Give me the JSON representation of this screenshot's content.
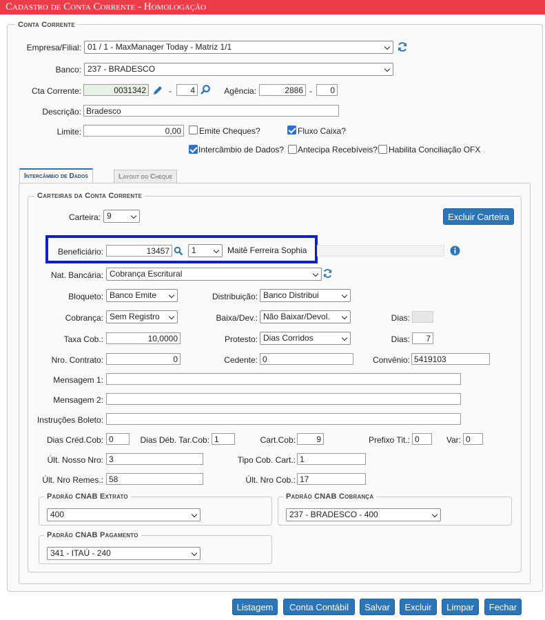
{
  "title": "Cadastro de Conta Corrente   - Homologação",
  "conta_corrente": {
    "legend": "Conta Corrente",
    "empresa_label": "Empresa/Filial:",
    "empresa_value": "01 / 1 - MaxManager Today - Matriz 1/1",
    "banco_label": "Banco:",
    "banco_value": "237 - BRADESCO",
    "cta_label": "Cta Corrente:",
    "cta_value": "0031342",
    "cta_digit": "4",
    "agencia_label": "Agência:",
    "agencia_value": "2886",
    "agencia_digit": "0",
    "descricao_label": "Descrição:",
    "descricao_value": "Bradesco",
    "limite_label": "Limite:",
    "limite_value": "0,00",
    "emite_cheques_label": "Emite Cheques?",
    "fluxo_caixa_label": "Fluxo Caixa?",
    "intercambio_label": "Intercâmbio de Dados?",
    "antecipa_label": "Antecipa Recebíveis?",
    "conciliacao_label": "Habilita Conciliação OFX"
  },
  "tabs": {
    "intercambio": "Intercâmbio de Dados",
    "layout_cheque": "Layout do Cheque"
  },
  "carteiras": {
    "legend": "Carteiras da Conta Corrente",
    "carteira_label": "Carteira:",
    "carteira_value": "9",
    "excluir_carteira": "Excluir Carteira",
    "beneficiario_label": "Beneficiário:",
    "beneficiario_code": "13457",
    "beneficiario_seq": "1",
    "beneficiario_name": "Maitê Ferreira Sophia",
    "nat_bancaria_label": "Nat. Bancária:",
    "nat_bancaria_value": "Cobrança Escritural",
    "bloqueto_label": "Bloqueto:",
    "bloqueto_value": "Banco Emite",
    "distribuicao_label": "Distribuição:",
    "distribuicao_value": "Banco Distribui",
    "cobranca_label": "Cobrança:",
    "cobranca_value": "Sem Registro",
    "baixa_label": "Baixa/Dev.:",
    "baixa_value": "Não Baixar/Devol.",
    "dias_label": "Dias:",
    "dias1_value": "",
    "taxa_label": "Taxa Cob.:",
    "taxa_value": "10,0000",
    "protesto_label": "Protesto:",
    "protesto_value": "Dias Corridos",
    "dias2_value": "7",
    "nro_contrato_label": "Nro. Contrato:",
    "nro_contrato_value": "0",
    "cedente_label": "Cedente:",
    "cedente_value": "0",
    "convenio_label": "Convênio:",
    "convenio_value": "5419103",
    "mensagem1_label": "Mensagem 1:",
    "mensagem1_value": "",
    "mensagem2_label": "Mensagem 2:",
    "mensagem2_value": "",
    "instrucoes_label": "Instruções Boleto:",
    "instrucoes_value": "",
    "dias_cred_label": "Dias Créd.Cob:",
    "dias_cred_value": "0",
    "dias_deb_label": "Dias Déb. Tar.Cob:",
    "dias_deb_value": "1",
    "cart_cob_label": "Cart.Cob:",
    "cart_cob_value": "9",
    "prefixo_label": "Prefixo Tit.:",
    "prefixo_value": "0",
    "var_label": "Var:",
    "var_value": "0",
    "ult_nosso_label": "Últ. Nosso Nro:",
    "ult_nosso_value": "3",
    "tipo_cob_label": "Tipo Cob. Cart.:",
    "tipo_cob_value": "1",
    "ult_remes_label": "Últ. Nro Remes.:",
    "ult_remes_value": "58",
    "ult_cob_label": "Últ. Nro Cob.:",
    "ult_cob_value": "17",
    "cnab_extrato_legend": "Padrão CNAB Extrato",
    "cnab_extrato_value": "400",
    "cnab_cobranca_legend": "Padrão CNAB Cobrança",
    "cnab_cobranca_value": "237 - BRADESCO - 400",
    "cnab_pagamento_legend": "Padrão CNAB Pagamento",
    "cnab_pagamento_value": "341 - ITAÚ - 240"
  },
  "footer": {
    "listagem": "Listagem",
    "conta_contabil": "Conta Contábil",
    "salvar": "Salvar",
    "excluir": "Excluir",
    "limpar": "Limpar",
    "fechar": "Fechar"
  },
  "colors": {
    "title_bar": "#ee3d4a",
    "button": "#2a76b9",
    "highlight_box": "#1020c8",
    "checkbox_on": "#2e6fd1"
  }
}
